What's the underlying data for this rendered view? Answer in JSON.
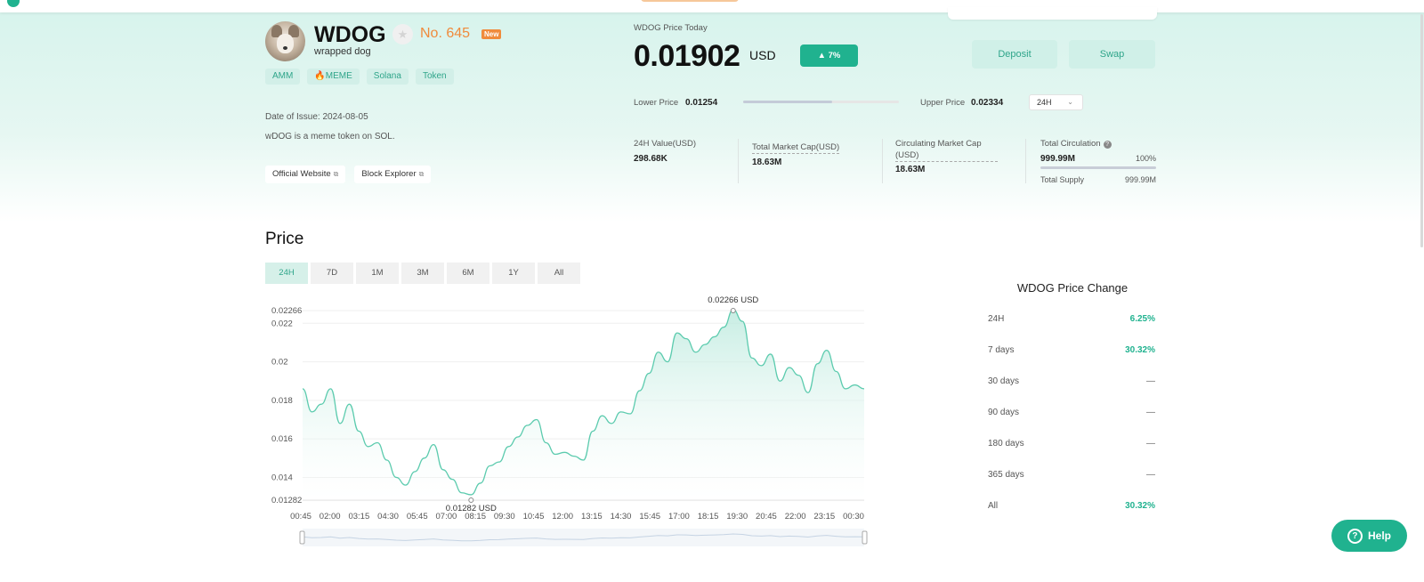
{
  "token": {
    "symbol": "WDOG",
    "name": "wrapped dog",
    "rank": "No. 645",
    "badge": "New",
    "tags": [
      "AMM",
      "🔥MEME",
      "Solana",
      "Token"
    ],
    "issue_date": "Date of Issue: 2024-08-05",
    "description": "wDOG is a meme token on SOL.",
    "links": [
      "Official Website",
      "Block Explorer"
    ]
  },
  "price_today": {
    "label": "WDOG Price Today",
    "value": "0.01902",
    "unit": "USD",
    "change": "▲ 7%"
  },
  "actions": {
    "deposit": "Deposit",
    "swap": "Swap"
  },
  "range": {
    "lower_label": "Lower Price",
    "lower_value": "0.01254",
    "upper_label": "Upper Price",
    "upper_value": "0.02334",
    "period": "24H",
    "position_fraction": 0.57
  },
  "stats": {
    "value_24h": {
      "label": "24H Value(USD)",
      "value": "298.68K"
    },
    "total_market_cap": {
      "label": "Total Market Cap(USD)",
      "value": "18.63M"
    },
    "circulating_market_cap": {
      "label": "Circulating Market Cap (USD)",
      "value": "18.63M"
    },
    "total_circulation": {
      "label": "Total Circulation",
      "value": "999.99M",
      "percent": "100%"
    },
    "total_supply": {
      "label": "Total Supply",
      "value": "999.99M"
    }
  },
  "chart_section": {
    "title": "Price",
    "tabs": [
      "24H",
      "7D",
      "1M",
      "3M",
      "6M",
      "1Y",
      "All"
    ],
    "active_tab": "24H"
  },
  "chart_data": {
    "type": "area",
    "y_ticks": [
      "0.02266",
      "0.022",
      "0.02",
      "0.018",
      "0.016",
      "0.014",
      "0.01282"
    ],
    "x_ticks": [
      "00:45",
      "02:00",
      "03:15",
      "04:30",
      "05:45",
      "07:00",
      "08:15",
      "09:30",
      "10:45",
      "12:00",
      "13:15",
      "14:30",
      "15:45",
      "17:00",
      "18:15",
      "19:30",
      "20:45",
      "22:00",
      "23:15",
      "00:30"
    ],
    "ylim": [
      0.01282,
      0.02266
    ],
    "max_label": "0.02266 USD",
    "min_label": "0.01282 USD",
    "series": [
      {
        "values": [
          0.0186,
          0.0174,
          0.0178,
          0.0186,
          0.0168,
          0.0178,
          0.0164,
          0.0156,
          0.0158,
          0.0149,
          0.014,
          0.0136,
          0.0143,
          0.015,
          0.0157,
          0.0144,
          0.0139,
          0.0132,
          0.0131,
          0.0137,
          0.0146,
          0.0148,
          0.0156,
          0.0161,
          0.0167,
          0.017,
          0.0158,
          0.0152,
          0.0153,
          0.0151,
          0.0149,
          0.0164,
          0.0172,
          0.0168,
          0.0174,
          0.0173,
          0.0185,
          0.0194,
          0.0205,
          0.02,
          0.0215,
          0.0212,
          0.0205,
          0.0209,
          0.0213,
          0.0218,
          0.0227,
          0.0221,
          0.0202,
          0.0198,
          0.0204,
          0.019,
          0.0197,
          0.0193,
          0.0184,
          0.0199,
          0.0206,
          0.0195,
          0.0186,
          0.0188,
          0.0186
        ]
      }
    ]
  },
  "price_change": {
    "title": "WDOG Price Change",
    "rows": [
      {
        "label": "24H",
        "value": "6.25%"
      },
      {
        "label": "7 days",
        "value": "30.32%"
      },
      {
        "label": "30 days",
        "value": "—"
      },
      {
        "label": "90 days",
        "value": "—"
      },
      {
        "label": "180 days",
        "value": "—"
      },
      {
        "label": "365 days",
        "value": "—"
      },
      {
        "label": "All",
        "value": "30.32%"
      }
    ]
  },
  "help": {
    "label": "Help"
  },
  "colors": {
    "accent": "#20b28f",
    "orange": "#f08b3c",
    "tag_bg": "#d2efe8"
  },
  "icons": [
    "star-icon",
    "external-link-icon",
    "chevron-down-icon",
    "info-icon",
    "help-icon"
  ]
}
